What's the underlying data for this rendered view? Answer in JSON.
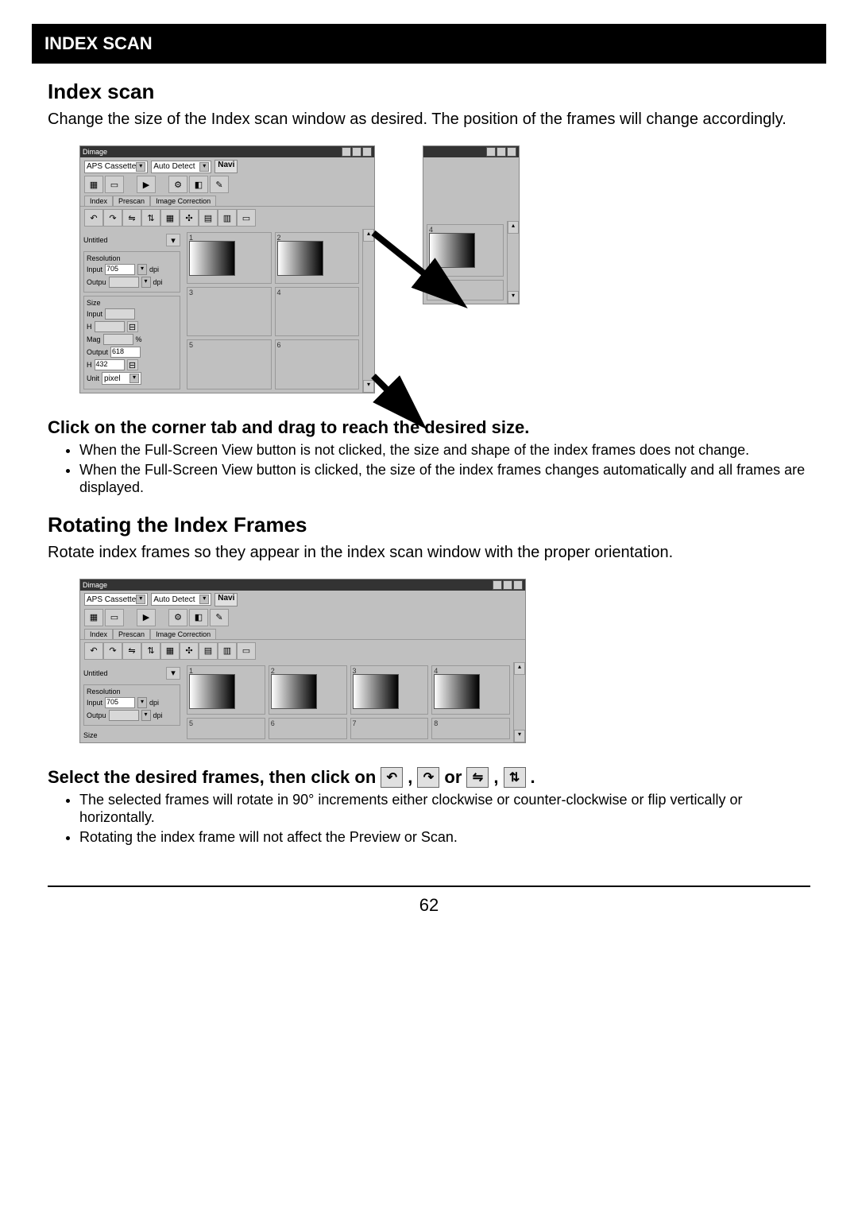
{
  "header": {
    "title": "INDEX SCAN"
  },
  "section1": {
    "heading": "Index scan",
    "body": "Change the size of the Index scan window as desired. The position of the frames will change accordingly."
  },
  "app": {
    "title": "Dimage",
    "filmType": "APS Cassette",
    "autoDetect": "Auto Detect",
    "navi": "Navi",
    "tabs": {
      "index": "Index",
      "prescan": "Prescan",
      "imgcorr": "Image Correction"
    },
    "panel": {
      "untitled": "Untitled",
      "resolution": "Resolution",
      "input_label": "Input",
      "input_val": "705",
      "dpi": "dpi",
      "output_label": "Outpu",
      "output_val": "",
      "size": "Size",
      "size_input": "Input",
      "size_input_val": "",
      "h": "H",
      "h_val": "",
      "mag": "Mag",
      "mag_val": "",
      "pct": "%",
      "output2": "Output",
      "output2_val": "618",
      "h2": "H",
      "h2_val": "432",
      "unit": "Unit",
      "unit_val": "pixel"
    },
    "thumbs": {
      "n1": "1",
      "n2": "2",
      "n3": "3",
      "n4": "4",
      "n5": "5",
      "n6": "6",
      "n7": "7",
      "n8": "8"
    }
  },
  "instr1": {
    "heading": "Click on the corner tab and drag to reach the desired size.",
    "b1": "When the Full-Screen View button is not clicked, the size and shape of the index frames does not change.",
    "b2": "When the Full-Screen View button is clicked, the size of the index frames changes automatically and all frames are displayed."
  },
  "section2": {
    "heading": "Rotating the Index Frames",
    "body": "Rotate index frames so they appear in the index scan window with the proper orientation."
  },
  "instr2": {
    "lead": "Select the desired frames, then click on",
    "comma": ",",
    "or": "or",
    "period": ".",
    "b1": "The selected frames will rotate in 90° increments either clockwise or counter-clockwise or flip vertically or horizontally.",
    "b2": "Rotating the index frame will not affect the Preview or Scan."
  },
  "page_number": "62"
}
